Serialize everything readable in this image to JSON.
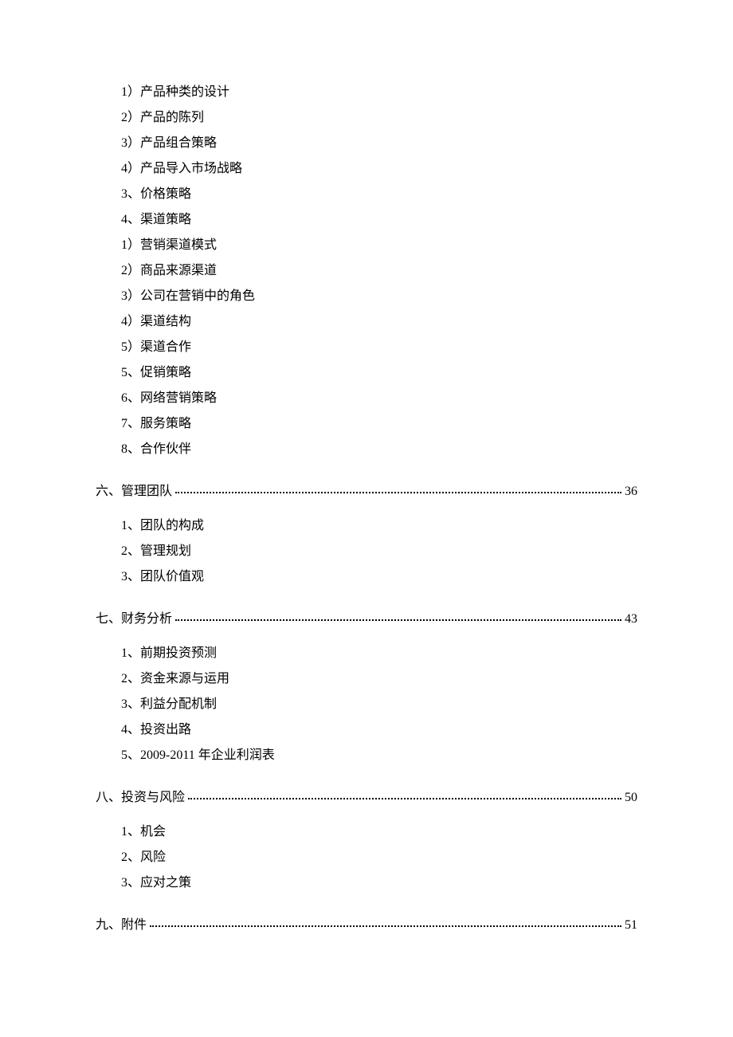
{
  "toc": {
    "preItems": [
      "1）产品种类的设计",
      "2）产品的陈列",
      "3）产品组合策略",
      "4）产品导入市场战略",
      "3、价格策略",
      "4、渠道策略",
      "1）营销渠道模式",
      "2）商品来源渠道",
      "3）公司在营销中的角色",
      "4）渠道结构",
      "5）渠道合作",
      "5、促销策略",
      "6、网络营销策略",
      "7、服务策略",
      "8、合作伙伴"
    ],
    "sections": [
      {
        "title": "六、管理团队",
        "page": "36",
        "subs": [
          "1、团队的构成",
          "2、管理规划",
          "3、团队价值观"
        ]
      },
      {
        "title": "七、财务分析",
        "page": "43",
        "subs": [
          "1、前期投资预测",
          "2、资金来源与运用",
          "3、利益分配机制",
          "4、投资出路",
          "5、2009-2011 年企业利润表"
        ]
      },
      {
        "title": "八、投资与风险",
        "page": "50",
        "subs": [
          "1、机会",
          "2、风险",
          "3、应对之策"
        ]
      },
      {
        "title": "九、附件",
        "page": "51",
        "subs": []
      }
    ]
  }
}
